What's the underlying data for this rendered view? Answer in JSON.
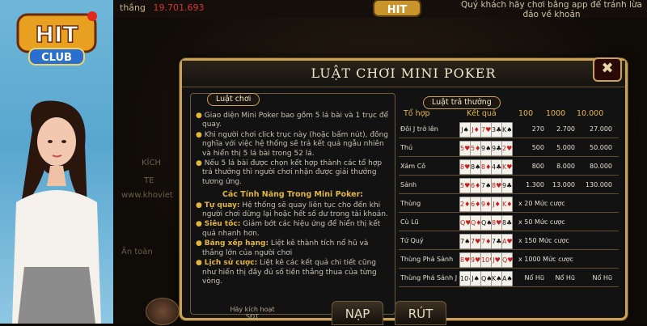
{
  "brand": {
    "logo_text": "HIT",
    "logo_sub": "CLUB"
  },
  "topbar": {
    "label": "thắng",
    "money": "19.701.693",
    "notice": "Quý khách hãy chơi bằng app để tránh lừa đảo về khoản"
  },
  "dialog": {
    "title": "LUẬT CHƠI MINI POKER",
    "close_label": "✖",
    "rules": {
      "label": "Luật chơi",
      "paragraphs": [
        "Giao diện Mini Poker bao gồm 5 lá bài và 1 trục để quay.",
        "Khi người chơi click trục này (hoặc bấm nút), đồng nghĩa với việc hệ thống sẽ trả kết quả ngẫu nhiên và hiển thị 5 lá bài trong 52 lá.",
        "Nếu 5 lá bài được chọn kết hợp thành các tổ hợp trả thưởng thì người chơi nhận được giải thưởng tương ứng."
      ],
      "features_title": "Các Tính Năng Trong Mini Poker:",
      "features": [
        {
          "name": "Tự quay:",
          "text": " Hệ thống sẽ quay liên tục cho đến khi người chơi dừng lại hoặc hết số dư trong tài khoản."
        },
        {
          "name": "Siêu tốc:",
          "text": " Giảm bớt các hiệu ứng để hiển thị kết quả nhanh hơn."
        },
        {
          "name": "Bảng xếp hạng:",
          "text": " Liệt kê thành tích nổ hũ và thắng lớn của người chơi"
        },
        {
          "name": "Lịch sử cược:",
          "text": " Liệt kê các kết quả chi tiết cũng như hiển thị đầy đủ số tiền thắng thua của từng vòng."
        }
      ]
    },
    "payouts": {
      "label": "Luật trả thưởng",
      "headers": {
        "combo": "Tổ hợp",
        "result": "Kết quả",
        "c100": "100",
        "c1000": "1000",
        "c10000": "10.000"
      },
      "rows": [
        {
          "name": "Đôi J trở lên",
          "cards": [
            "J♠",
            "J♦",
            "7♥",
            "3♣",
            "K♠"
          ],
          "v100": "270",
          "v1000": "2.700",
          "v10000": "27.000"
        },
        {
          "name": "Thú",
          "cards": [
            "5♥",
            "5♦",
            "9♠",
            "9♣",
            "2♥"
          ],
          "v100": "500",
          "v1000": "5.000",
          "v10000": "50.000"
        },
        {
          "name": "Xám Cô",
          "cards": [
            "8♥",
            "8♠",
            "8♦",
            "4♣",
            "K♥"
          ],
          "v100": "800",
          "v1000": "8.000",
          "v10000": "80.000"
        },
        {
          "name": "Sảnh",
          "cards": [
            "5♥",
            "6♦",
            "7♠",
            "8♥",
            "9♣"
          ],
          "v100": "1.300",
          "v1000": "13.000",
          "v10000": "130.000"
        },
        {
          "name": "Thùng",
          "cards": [
            "2♦",
            "6♦",
            "9♦",
            "J♦",
            "K♦"
          ],
          "mult": "x 20 Mức cược"
        },
        {
          "name": "Cù Lũ",
          "cards": [
            "Q♥",
            "Q♦",
            "Q♠",
            "8♥",
            "8♣"
          ],
          "mult": "x 50 Mức cược"
        },
        {
          "name": "Tứ Quý",
          "cards": [
            "7♠",
            "7♥",
            "7♦",
            "7♣",
            "A♥"
          ],
          "mult": "x 150 Mức cược"
        },
        {
          "name": "Thùng Phá Sảnh",
          "cards": [
            "8♥",
            "9♥",
            "10♥",
            "J♥",
            "Q♥"
          ],
          "mult": "x 1000 Mức cược"
        },
        {
          "name": "Thùng Phá Sảnh J",
          "cards": [
            "10♠",
            "J♠",
            "Q♠",
            "K♠",
            "A♠"
          ],
          "v100": "Nổ Hũ",
          "v1000": "Nổ Hũ",
          "v10000": "Nổ Hũ"
        }
      ]
    }
  },
  "bottom": {
    "hint": "Hãy kích hoạt SĐT",
    "nap": "NẠP",
    "rut": "RÚT"
  },
  "side": {
    "site": "www.khoviet",
    "left_a": "Ăn toàn",
    "left_b": "TE",
    "left_c": "KÍCH"
  }
}
